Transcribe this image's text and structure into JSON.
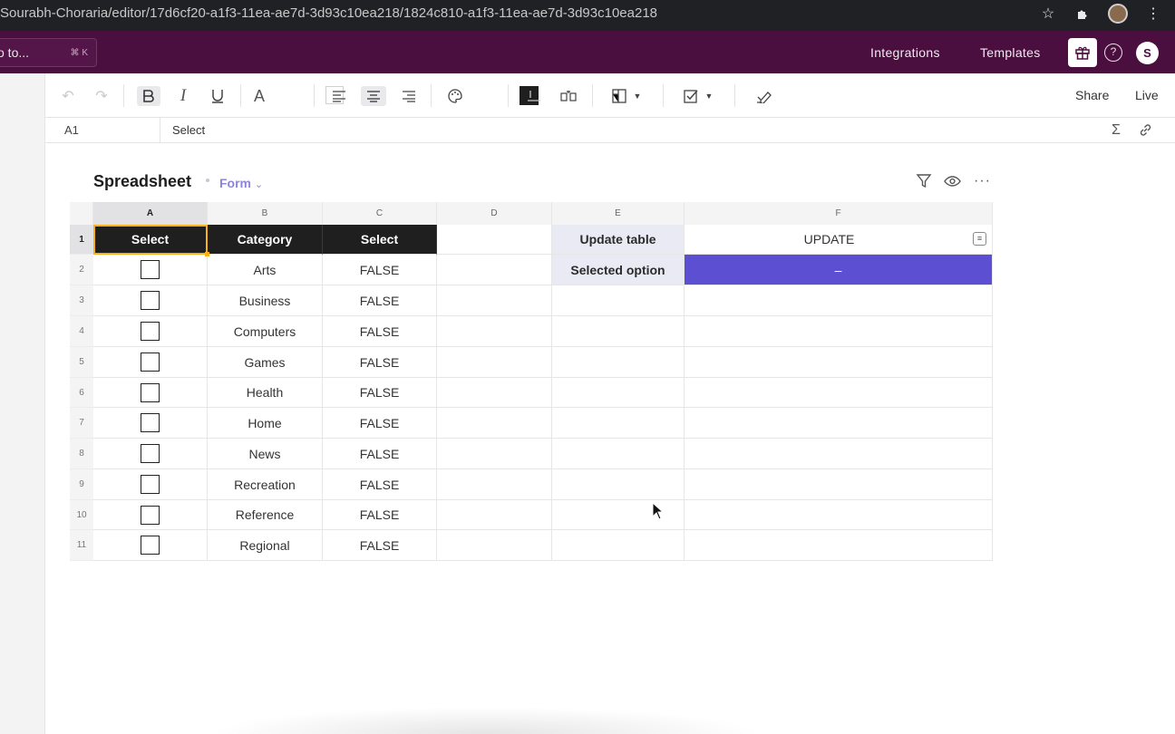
{
  "browser": {
    "url": "Sourabh-Choraria/editor/17d6cf20-a1f3-11ea-ae7d-3d93c10ea218/1824c810-a1f3-11ea-ae7d-3d93c10ea218",
    "icons": [
      "star-icon",
      "extensions-icon",
      "profile-avatar",
      "menu-kebab-icon"
    ]
  },
  "app_bar": {
    "jump_label": "o to...",
    "jump_shortcut": "⌘ K",
    "integrations": "Integrations",
    "templates": "Templates",
    "user_initial": "S"
  },
  "toolbar": {
    "share": "Share",
    "live": "Live"
  },
  "formula_bar": {
    "cell_ref": "A1",
    "value": "Select"
  },
  "sheet": {
    "title": "Spreadsheet",
    "view": "Form"
  },
  "grid": {
    "columns": [
      "A",
      "B",
      "C",
      "D",
      "E",
      "F"
    ],
    "header_row": [
      "Select",
      "Category",
      "Select"
    ],
    "rows": [
      {
        "num": "1"
      },
      {
        "num": "2",
        "category": "Arts",
        "select": "FALSE"
      },
      {
        "num": "3",
        "category": "Business",
        "select": "FALSE"
      },
      {
        "num": "4",
        "category": "Computers",
        "select": "FALSE"
      },
      {
        "num": "5",
        "category": "Games",
        "select": "FALSE"
      },
      {
        "num": "6",
        "category": "Health",
        "select": "FALSE"
      },
      {
        "num": "7",
        "category": "Home",
        "select": "FALSE"
      },
      {
        "num": "8",
        "category": "News",
        "select": "FALSE"
      },
      {
        "num": "9",
        "category": "Recreation",
        "select": "FALSE"
      },
      {
        "num": "10",
        "category": "Reference",
        "select": "FALSE"
      },
      {
        "num": "11",
        "category": "Regional",
        "select": "FALSE"
      }
    ],
    "side": {
      "update_label": "Update table",
      "update_value": "UPDATE",
      "selected_label": "Selected option",
      "selected_value": "–"
    }
  },
  "colors": {
    "app_bar": "#4a0e3f",
    "header_cell": "#1f1f1f",
    "selected_option": "#5c4fd1",
    "label_cell": "#eaeaf5",
    "active_outline": "#f5b21b",
    "form_tag": "#8d85d9"
  }
}
